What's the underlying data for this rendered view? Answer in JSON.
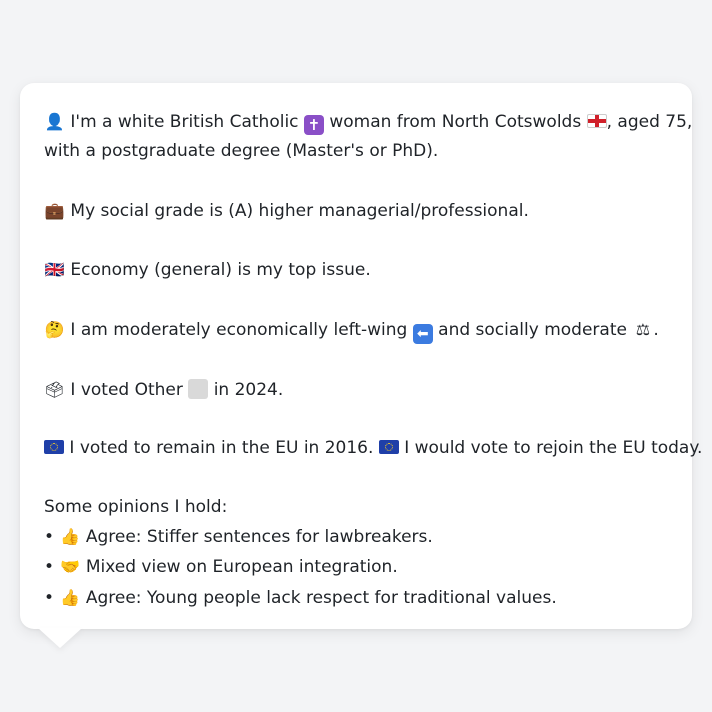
{
  "profile": {
    "identity": {
      "icon": "person-icon",
      "text_a": "I'm a white British Catholic",
      "icon_religion": "latin-cross-icon",
      "text_b": "woman from North Cotswolds",
      "icon_flag": "england-flag-icon",
      "text_c": ", aged 75,",
      "text_d": "with a postgraduate degree (Master's or PhD)."
    },
    "social_grade": {
      "icon": "briefcase-icon",
      "text": "My social grade is (A) higher managerial/professional."
    },
    "top_issue": {
      "icon": "newspaper-flag-icon",
      "text": "Economy (general) is my top issue."
    },
    "ideology": {
      "icon": "thinking-face-icon",
      "text_a": "I am moderately economically left-wing",
      "icon_left": "left-arrow-icon",
      "text_b": "and socially moderate",
      "icon_scale": "balance-scale-icon",
      "text_c": "."
    },
    "vote_2024": {
      "icon": "ballot-box-icon",
      "text_a": "I voted Other",
      "icon_party": "grey-square-icon",
      "text_b": "in 2024."
    },
    "eu": {
      "icon_a": "eu-flag-icon",
      "text_a": "I voted to remain in the EU in 2016.",
      "icon_b": "eu-flag-icon",
      "text_b": "I would vote to rejoin the EU today."
    },
    "opinions": {
      "heading": "Some opinions I hold:",
      "bullet": "•",
      "items": [
        {
          "icon": "thumbs-up-icon",
          "text": "Agree: Stiffer sentences for lawbreakers."
        },
        {
          "icon": "handshake-icon",
          "text": "Mixed view on European integration."
        },
        {
          "icon": "thumbs-up-icon",
          "text": "Agree: Young people lack respect for traditional values."
        }
      ]
    }
  }
}
